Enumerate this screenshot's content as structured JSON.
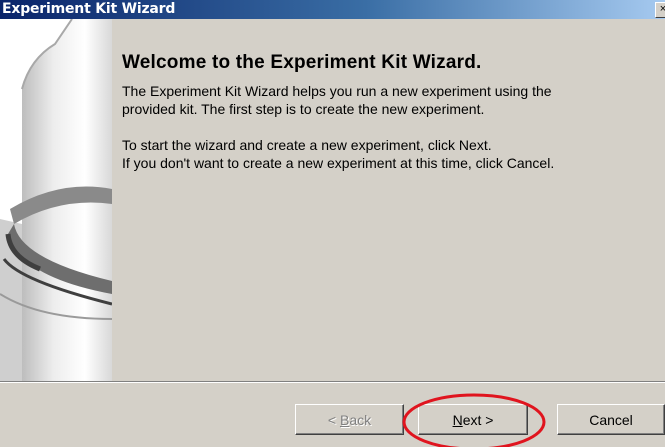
{
  "window": {
    "title": "Experiment Kit Wizard",
    "close_glyph": "×"
  },
  "main": {
    "heading": "Welcome to the Experiment Kit Wizard.",
    "paragraph1": "The Experiment Kit Wizard helps you run a new experiment using the provided kit. The first step is to create the new experiment.",
    "paragraph2_line1": "To start the wizard and create a new experiment, click Next.",
    "paragraph2_line2": "If you don't want to create a new experiment at this time, click Cancel."
  },
  "buttons": {
    "back_prefix": "< ",
    "back_mnemonic": "B",
    "back_rest": "ack",
    "next_mnemonic": "N",
    "next_rest": "ext >",
    "cancel": "Cancel"
  },
  "annotation": {
    "circle_color": "#e0141e",
    "target": "Next >"
  }
}
